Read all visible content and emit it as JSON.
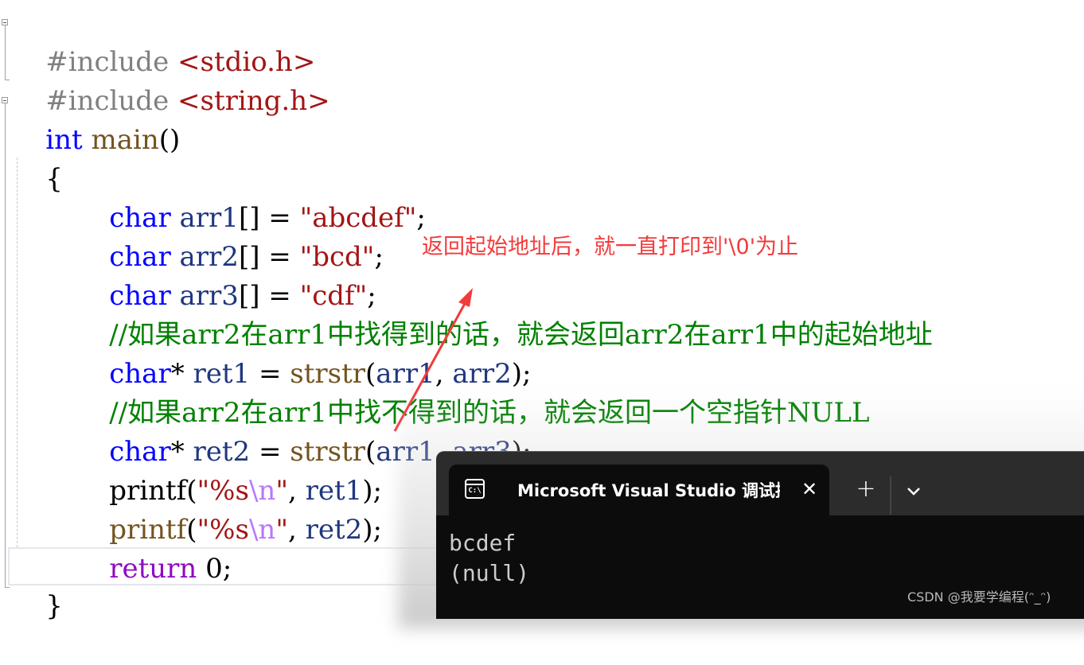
{
  "code": {
    "include1": {
      "directive": "#include",
      "header": "<stdio.h>"
    },
    "include2": {
      "directive": "#include",
      "header": "<string.h>"
    },
    "main_sig": {
      "type": "int",
      "name": "main",
      "parens": "()"
    },
    "open_brace": "{",
    "arr1": {
      "type": "char",
      "name": "arr1",
      "decl": "[] = ",
      "value": "\"abcdef\"",
      "end": ";"
    },
    "arr2": {
      "type": "char",
      "name": "arr2",
      "decl": "[] = ",
      "value": "\"bcd\"",
      "end": ";"
    },
    "arr3": {
      "type": "char",
      "name": "arr3",
      "decl": "[] = ",
      "value": "\"cdf\"",
      "end": ";"
    },
    "comment1": "//如果arr2在arr1中找得到的话，就会返回arr2在arr1中的起始地址",
    "ret1": {
      "type": "char",
      "star": "*",
      "name": "ret1",
      "eq": " = ",
      "func": "strstr",
      "open": "(",
      "arg1": "arr1",
      "comma": ", ",
      "arg2": "arr2",
      "close": ");"
    },
    "comment2": "//如果arr2在arr1中找不得到的话，就会返回一个空指针NULL",
    "ret2": {
      "type": "char",
      "star": "*",
      "name": "ret2",
      "eq": " = ",
      "func": "strstr",
      "open": "(",
      "arg1": "arr1",
      "comma": ", ",
      "arg2": "arr3",
      "close": ");"
    },
    "printf1": {
      "func": "printf",
      "open": "(",
      "fmt": "\"%s",
      "esc": "\\n",
      "fmt_end": "\"",
      "comma": ", ",
      "arg": "ret1",
      "close": ");"
    },
    "printf2": {
      "func": "printf",
      "open": "(",
      "fmt": "\"%s",
      "esc": "\\n",
      "fmt_end": "\"",
      "comma": ", ",
      "arg": "ret2",
      "close": ");"
    },
    "return_stmt": {
      "keyword": "return",
      "value": " 0;"
    },
    "close_brace": "}"
  },
  "annotation": {
    "text": "返回起始地址后，就一直打印到'\\0'为止",
    "color": "#f23b3b"
  },
  "terminal": {
    "tab_icon": "terminal-icon",
    "icon_text": "C:\\",
    "tab_title": "Microsoft Visual Studio 调试控制台",
    "close_glyph": "✕",
    "new_tab_glyph": "+",
    "output": [
      "bcdef",
      "(null)"
    ]
  },
  "watermark": "CSDN @我要学编程(ᵔ_ᵔ)"
}
